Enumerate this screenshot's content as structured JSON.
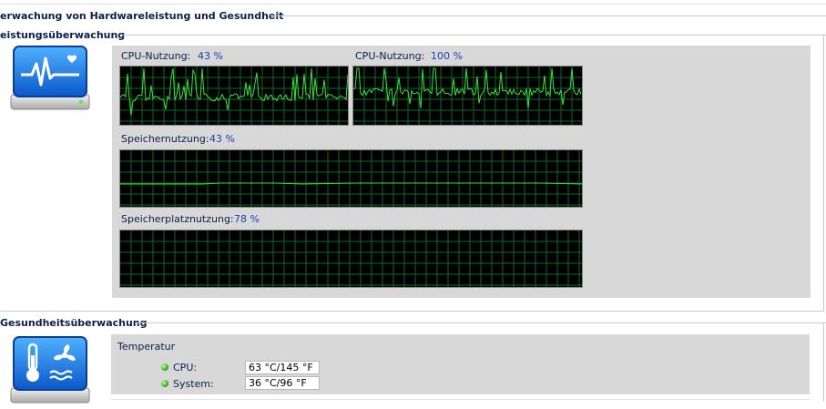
{
  "header": {
    "title": "erwachung von Hardwareleistung und Gesundheit"
  },
  "performance": {
    "title": "eistungsüberwachung",
    "cpu1": {
      "label": "CPU-Nutzung:",
      "value": "43 %"
    },
    "cpu2": {
      "label": "CPU-Nutzung:",
      "value": "100 %"
    },
    "memory": {
      "label": "Speichernutzung:",
      "value": "43 %"
    },
    "disk": {
      "label": "Speicherplatznutzung:",
      "value": "78 %"
    }
  },
  "health": {
    "title": "Gesundheitsüberwachung",
    "temperature_label": "Temperatur",
    "rows": [
      {
        "label": "CPU:",
        "value": "63 °C/145 °F"
      },
      {
        "label": "System:",
        "value": "36 °C/96 °F"
      }
    ]
  },
  "colors": {
    "graph_grid": "#0b6a2a",
    "graph_line": "#37e23a",
    "status_ok": "#2fa313"
  },
  "icons": {
    "performance": "heart-monitor-icon",
    "health": "temperature-fan-icon"
  }
}
